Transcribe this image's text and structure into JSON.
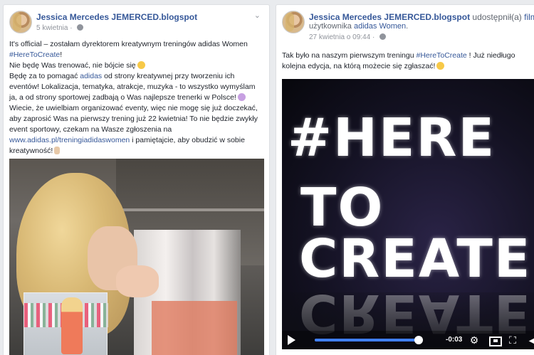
{
  "post1": {
    "author": "Jessica Mercedes JEMERCED.blogspot",
    "date": "5 kwietnia",
    "dot": "·",
    "lines": {
      "l1": "It's official – zostałam dyrektorem kreatywnym treningów adidas Women",
      "hashtag": "#HereToCreate",
      "hashtag_suffix": "!",
      "l3": "Nie będę Was trenować, nie bójcie się",
      "l4a": "Będę za to pomagać ",
      "brand": "adidas",
      "l4b": " od strony kreatywnej przy tworzeniu ich eventów! Lokalizacja, tematyka, atrakcje, muzyka - to wszystko wymyślam ja, a od strony sportowej zadbają o Was najlepsze trenerki w Polsce!",
      "l5": "Wiecie, że uwielbiam organizować eventy, więc nie mogę się już doczekać, aby zaprosić Was na pierwszy trening już 22 kwietnia! To nie będzie zwykły event sportowy, czekam na Wasze zgłoszenia na",
      "url": "www.adidas.pl/treningiadidaswomen",
      "l6": " i pamiętajcie, aby obudzić w sobie kreatywność!"
    }
  },
  "post2": {
    "author": "Jessica Mercedes JEMERCED.blogspot",
    "shared": " udostępnił(a) ",
    "film": "film",
    "user_prefix": "użytkownika ",
    "user": "adidas Women",
    "user_suffix": ".",
    "date": "27 kwietnia o 09:44",
    "dot": "·",
    "text_a": "Tak było na naszym pierwszym treningu ",
    "hashtag": "#HereToCreate",
    "text_b": " ! Już niedługo kolejna edycja, na którą możecie się zgłaszać!",
    "video": {
      "line1": "#HERE",
      "line2": "TO",
      "line3": "CREATE",
      "time": "-0:03",
      "progress": 0.97
    }
  },
  "icons": {
    "chevron": "chevron-down-icon",
    "globe": "globe-icon",
    "play": "play-icon",
    "gear": "gear-icon",
    "fullscreen": "fullscreen-icon",
    "volume": "volume-icon"
  },
  "colors": {
    "link": "#365899",
    "progress": "#4080ff",
    "background": "#e9ebee"
  }
}
